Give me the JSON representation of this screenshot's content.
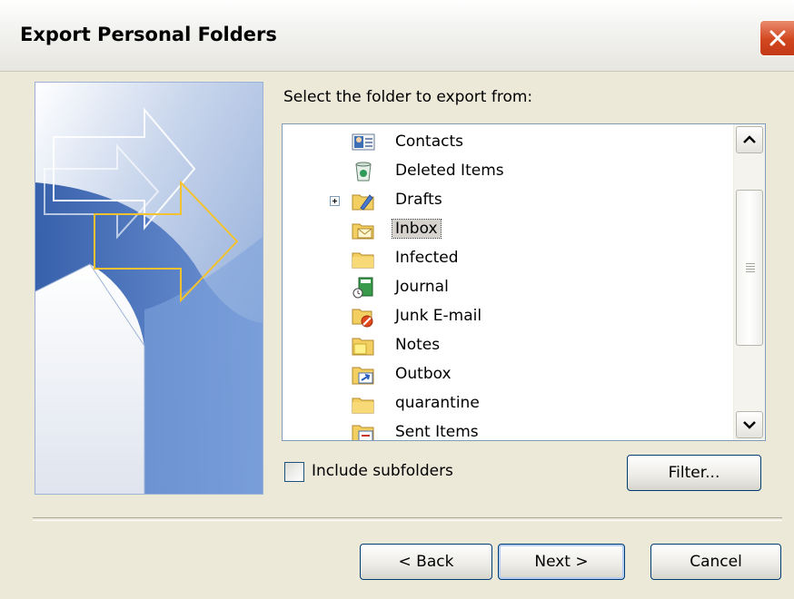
{
  "window": {
    "title": "Export Personal Folders",
    "close_icon": "close-icon"
  },
  "prompt": "Select the folder to export from:",
  "folders": [
    {
      "label": "Contacts",
      "icon": "contacts-icon",
      "expandable": false,
      "selected": false
    },
    {
      "label": "Deleted Items",
      "icon": "deleted-items-icon",
      "expandable": false,
      "selected": false
    },
    {
      "label": "Drafts",
      "icon": "drafts-folder-icon",
      "expandable": true,
      "selected": false
    },
    {
      "label": "Inbox",
      "icon": "inbox-folder-icon",
      "expandable": false,
      "selected": true
    },
    {
      "label": "Infected",
      "icon": "folder-icon",
      "expandable": false,
      "selected": false
    },
    {
      "label": "Journal",
      "icon": "journal-icon",
      "expandable": false,
      "selected": false
    },
    {
      "label": "Junk E-mail",
      "icon": "junk-email-folder-icon",
      "expandable": false,
      "selected": false
    },
    {
      "label": "Notes",
      "icon": "notes-icon",
      "expandable": false,
      "selected": false
    },
    {
      "label": "Outbox",
      "icon": "outbox-folder-icon",
      "expandable": false,
      "selected": false
    },
    {
      "label": "quarantine",
      "icon": "folder-icon",
      "expandable": false,
      "selected": false
    },
    {
      "label": "Sent Items",
      "icon": "sent-items-folder-icon",
      "expandable": false,
      "selected": false
    }
  ],
  "include_subfolders": {
    "label": "Include subfolders",
    "checked": false
  },
  "buttons": {
    "filter": "Filter...",
    "back": "< Back",
    "next": "Next >",
    "cancel": "Cancel"
  },
  "colors": {
    "dialog_bg": "#ece9d8",
    "close_button": "#d2461f",
    "button_border": "#003c74",
    "arrow_accent": "#f2c230"
  }
}
